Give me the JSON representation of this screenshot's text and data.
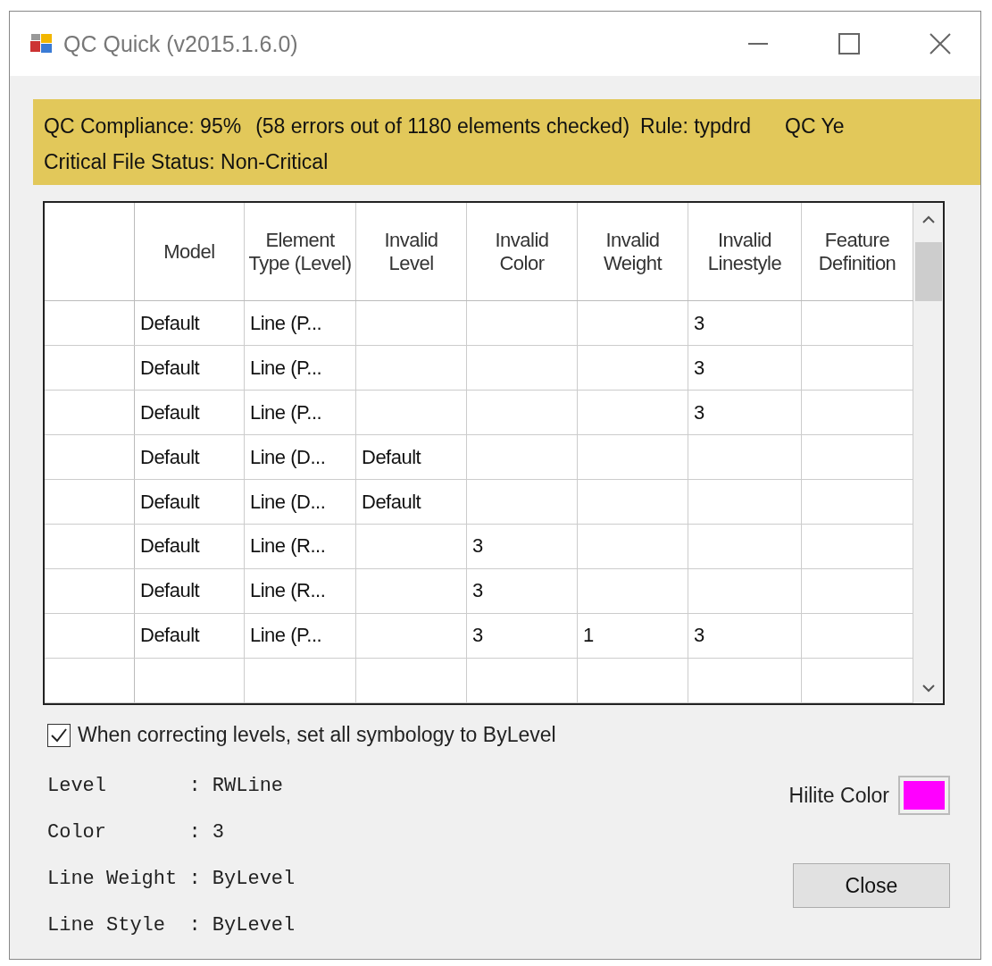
{
  "window": {
    "title": "QC Quick (v2015.1.6.0)"
  },
  "banner": {
    "line_1": [
      "QC Compliance: 95%",
      "(58 errors out of 1180 elements checked)",
      "Rule: typdrd",
      "QC Ye"
    ],
    "line_2": "Critical File Status: Non-Critical"
  },
  "table": {
    "columns": [
      "Model",
      "Element Type (Level)",
      "Invalid Level",
      "Invalid Color",
      "Invalid Weight",
      "Invalid Linestyle",
      "Feature Definition"
    ],
    "rows": [
      [
        "Default",
        "Line (P...",
        null,
        null,
        null,
        "3",
        null
      ],
      [
        "Default",
        "Line (P...",
        null,
        null,
        null,
        "3",
        null
      ],
      [
        "Default",
        "Line (P...",
        null,
        null,
        null,
        "3",
        null
      ],
      [
        "Default",
        "Line (D...",
        "Default",
        null,
        null,
        null,
        null
      ],
      [
        "Default",
        "Line (D...",
        "Default",
        null,
        null,
        null,
        null
      ],
      [
        "Default",
        "Line (R...",
        null,
        "3",
        null,
        null,
        null
      ],
      [
        "Default",
        "Line (R...",
        null,
        "3",
        null,
        null,
        null
      ],
      [
        "Default",
        "Line (P...",
        null,
        "3",
        "1",
        "3",
        null
      ]
    ]
  },
  "option": {
    "label": "When correcting levels, set all symbology to ByLevel",
    "checked": true
  },
  "details": [
    "Level       : RWLine",
    "Color       : 3",
    "Line Weight : ByLevel",
    "Line Style  : ByLevel"
  ],
  "hilite": {
    "label": "Hilite Color",
    "color": "#ff00ff"
  },
  "buttons": [
    "Close"
  ]
}
